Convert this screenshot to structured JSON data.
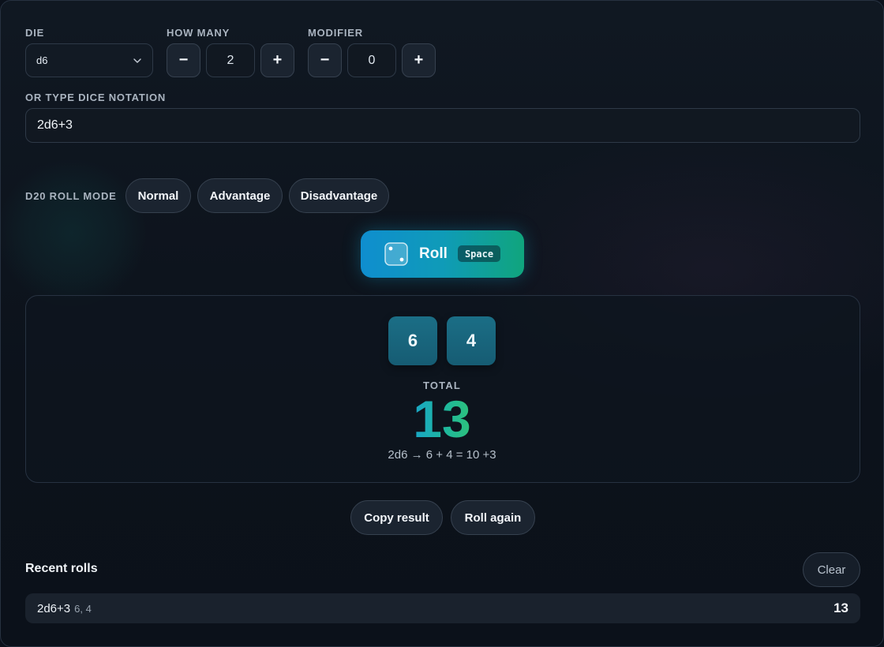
{
  "controls": {
    "die_label": "DIE",
    "die_value": "d6",
    "count_label": "HOW MANY",
    "count_value": "2",
    "modifier_label": "MODIFIER",
    "modifier_value": "0",
    "minus": "−",
    "plus": "+"
  },
  "notation": {
    "label": "OR TYPE DICE NOTATION",
    "value": "2d6+3"
  },
  "mode": {
    "label": "D20 ROLL MODE",
    "options": [
      "Normal",
      "Advantage",
      "Disadvantage"
    ]
  },
  "roll": {
    "label": "Roll",
    "shortcut": "Space",
    "icon": "die-icon"
  },
  "result": {
    "dice": [
      "6",
      "4"
    ],
    "total_label": "TOTAL",
    "total": "13",
    "breakdown": "2d6 → 6 + 4 = 10 +3"
  },
  "actions": {
    "copy": "Copy result",
    "again": "Roll again"
  },
  "recent": {
    "title": "Recent rolls",
    "clear": "Clear",
    "items": [
      {
        "expr": "2d6+3",
        "rolls": "6, 4",
        "total": "13"
      }
    ]
  },
  "colors": {
    "accent_start": "#0f8ecf",
    "accent_end": "#10a57d",
    "die_face": "#1b6e86"
  }
}
